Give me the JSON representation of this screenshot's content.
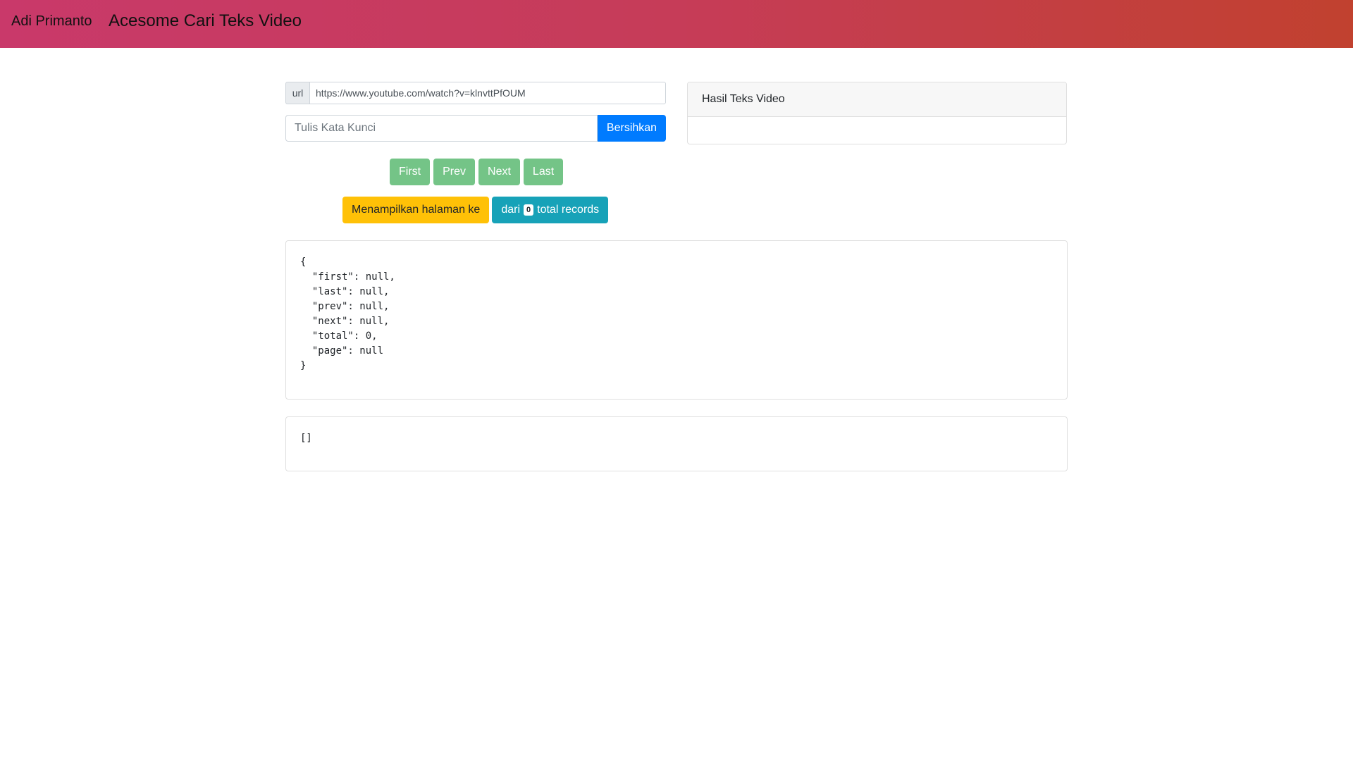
{
  "navbar": {
    "brand": "Adi Primanto",
    "title": "Acesome Cari Teks Video"
  },
  "url_field": {
    "prefix": "url",
    "value": "https://www.youtube.com/watch?v=klnvttPfOUM"
  },
  "keyword_field": {
    "placeholder": "Tulis Kata Kunci",
    "value": "",
    "clear_label": "Bersihkan"
  },
  "pager": {
    "first": "First",
    "prev": "Prev",
    "next": "Next",
    "last": "Last"
  },
  "status": {
    "page_text": "Menampilkan halaman ke",
    "from_text": "dari",
    "total": "0",
    "records_text": "total records"
  },
  "result_card": {
    "header": "Hasil Teks Video",
    "body": ""
  },
  "pager_json": "{\n  \"first\": null,\n  \"last\": null,\n  \"prev\": null,\n  \"next\": null,\n  \"total\": 0,\n  \"page\": null\n}",
  "results_json": "[]",
  "colors": {
    "navbar_start": "#c9396a",
    "navbar_end": "#c1412f",
    "primary": "#007bff",
    "pager_button": "#74c487",
    "warning": "#ffc107",
    "info": "#17a2b8"
  }
}
